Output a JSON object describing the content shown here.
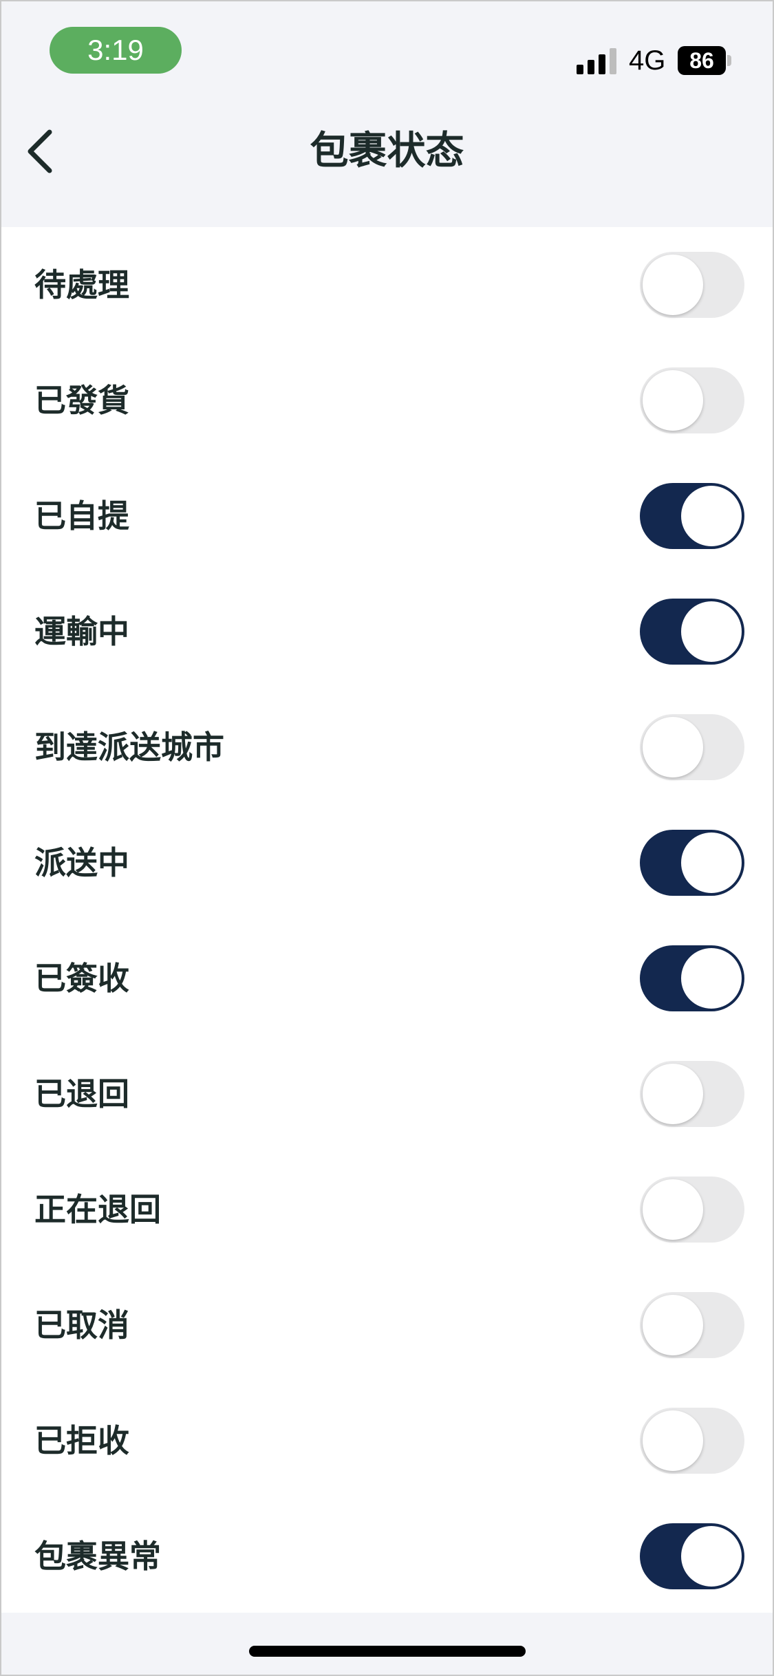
{
  "status_bar": {
    "time": "3:19",
    "network": "4G",
    "battery": "86",
    "signal_icon": "cellular-signal-icon",
    "time_pill_color": "#5CAE5F"
  },
  "nav": {
    "back_icon": "chevron-left-icon",
    "title": "包裹状态"
  },
  "colors": {
    "toggle_on": "#13284F",
    "toggle_off": "#E9E9EA",
    "text": "#1D2B2A",
    "background": "#F3F4F8"
  },
  "items": [
    {
      "label": "待處理",
      "on": false
    },
    {
      "label": "已發貨",
      "on": false
    },
    {
      "label": "已自提",
      "on": true
    },
    {
      "label": "運輸中",
      "on": true
    },
    {
      "label": "到達派送城市",
      "on": false
    },
    {
      "label": "派送中",
      "on": true
    },
    {
      "label": "已簽收",
      "on": true
    },
    {
      "label": "已退回",
      "on": false
    },
    {
      "label": "正在退回",
      "on": false
    },
    {
      "label": "已取消",
      "on": false
    },
    {
      "label": "已拒收",
      "on": false
    },
    {
      "label": "包裹異常",
      "on": true
    }
  ]
}
